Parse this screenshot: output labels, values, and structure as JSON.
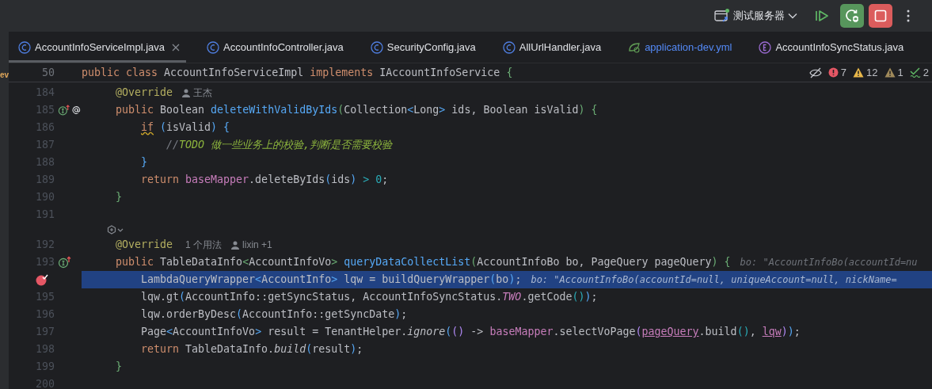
{
  "toolbar": {
    "run_config": "测试服务器"
  },
  "tabs": [
    {
      "label": "AccountInfoServiceImpl.java",
      "kind": "class",
      "selected": true,
      "modified": false
    },
    {
      "label": "AccountInfoController.java",
      "kind": "class",
      "selected": false,
      "modified": false
    },
    {
      "label": "SecurityConfig.java",
      "kind": "class",
      "selected": false,
      "modified": false
    },
    {
      "label": "AllUrlHandler.java",
      "kind": "class",
      "selected": false,
      "modified": false
    },
    {
      "label": "application-dev.yml",
      "kind": "spring",
      "selected": false,
      "modified": true
    },
    {
      "label": "AccountInfoSyncStatus.java",
      "kind": "enum",
      "selected": false,
      "modified": false
    }
  ],
  "side_fragment": "ev",
  "sticky_line": {
    "number": "50",
    "tokens": [
      {
        "t": "public class ",
        "kind": "keyword"
      },
      {
        "t": "AccountInfoServiceImpl ",
        "kind": "plain"
      },
      {
        "t": "implements ",
        "kind": "keyword"
      },
      {
        "t": "IAccountInfoService ",
        "kind": "plain"
      },
      {
        "t": "{",
        "kind": "brace1"
      }
    ]
  },
  "inspections": [
    {
      "kind": "error",
      "count": "7"
    },
    {
      "kind": "warning",
      "count": "12"
    },
    {
      "kind": "weak",
      "count": "1"
    },
    {
      "kind": "typo",
      "count": "2"
    }
  ],
  "lines": [
    {
      "number": "184",
      "implements": false,
      "mention": false,
      "breakpoint": false,
      "current": false,
      "tokens": [
        {
          "t": "@Override",
          "kind": "annotation"
        }
      ],
      "hints": [
        {
          "kind": "author",
          "t": "王杰"
        }
      ]
    },
    {
      "number": "185",
      "implements": true,
      "mention": true,
      "breakpoint": false,
      "current": false,
      "tokens": [
        {
          "t": "public",
          "kind": "keyword"
        },
        {
          "t": " Boolean ",
          "kind": "plain"
        },
        {
          "t": "deleteWithValidByIds",
          "kind": "method"
        },
        {
          "t": "(",
          "kind": "brace1"
        },
        {
          "t": "Collection",
          "kind": "plain"
        },
        {
          "t": "<",
          "kind": "brace2"
        },
        {
          "t": "Long",
          "kind": "plain"
        },
        {
          "t": ">",
          "kind": "brace2"
        },
        {
          "t": " ids, Boolean isValid",
          "kind": "plain"
        },
        {
          "t": ")",
          "kind": "brace1"
        },
        {
          "t": " {",
          "kind": "brace1"
        }
      ],
      "children": [
        {
          "number": "186",
          "implements": false,
          "mention": false,
          "breakpoint": false,
          "current": false,
          "tokens": [
            {
              "t": "if",
              "kind": "squiggle"
            },
            {
              "t": " (",
              "kind": "brace2"
            },
            {
              "t": "isValid",
              "kind": "plain"
            },
            {
              "t": ")",
              "kind": "brace2"
            },
            {
              "t": " {",
              "kind": "brace2"
            }
          ],
          "children": [
            {
              "number": "187",
              "implements": false,
              "mention": false,
              "breakpoint": false,
              "current": false,
              "tokens": [
                {
                  "t": "//",
                  "kind": "comment"
                },
                {
                  "t": "TODO 做一些业务上的校验,判断是否需要校验",
                  "kind": "todo"
                }
              ]
            }
          ]
        },
        {
          "number": "188",
          "implements": false,
          "mention": false,
          "breakpoint": false,
          "current": false,
          "tokens": [
            {
              "t": "}",
              "kind": "brace2"
            }
          ]
        },
        {
          "number": "189",
          "implements": false,
          "mention": false,
          "breakpoint": false,
          "current": false,
          "tokens": [
            {
              "t": "return ",
              "kind": "keyword"
            },
            {
              "t": "baseMapper",
              "kind": "field"
            },
            {
              "t": ".deleteByIds",
              "kind": "plain"
            },
            {
              "t": "(",
              "kind": "brace2"
            },
            {
              "t": "ids",
              "kind": "plain"
            },
            {
              "t": ")",
              "kind": "brace2"
            },
            {
              "t": " > ",
              "kind": "brace3"
            },
            {
              "t": "0",
              "kind": "number"
            },
            {
              "t": ";",
              "kind": "plain"
            }
          ]
        }
      ]
    },
    {
      "number": "190",
      "implements": false,
      "mention": false,
      "breakpoint": false,
      "current": false,
      "tokens": [
        {
          "t": "}",
          "kind": "brace1"
        }
      ]
    },
    {
      "number": "191",
      "implements": false,
      "mention": false,
      "breakpoint": false,
      "current": false
    },
    {
      "number": "192",
      "implements": false,
      "mention": false,
      "breakpoint": false,
      "current": false,
      "inlay_above": true,
      "tokens": [
        {
          "t": "@Override",
          "kind": "annotation"
        }
      ],
      "hints": [
        {
          "kind": "usages",
          "t": "1 个用法"
        },
        {
          "kind": "author",
          "t": "lixin +1"
        }
      ]
    },
    {
      "number": "193",
      "implements": true,
      "mention": false,
      "breakpoint": false,
      "current": false,
      "tokens": [
        {
          "t": "public",
          "kind": "keyword"
        },
        {
          "t": " TableDataInfo",
          "kind": "plain"
        },
        {
          "t": "<",
          "kind": "brace1"
        },
        {
          "t": "AccountInfoVo",
          "kind": "plain"
        },
        {
          "t": "> ",
          "kind": "brace1"
        },
        {
          "t": "queryDataCollectList",
          "kind": "method"
        },
        {
          "t": "(",
          "kind": "brace1"
        },
        {
          "t": "AccountInfoBo bo, PageQuery pageQuery",
          "kind": "plain"
        },
        {
          "t": ")",
          "kind": "brace1"
        },
        {
          "t": " {",
          "kind": "brace1"
        }
      ],
      "debug": "bo: \"AccountInfoBo(accountId=nu",
      "children": [
        {
          "implements": false,
          "mention": false,
          "breakpoint": true,
          "current": true,
          "tokens": [
            {
              "t": "LambdaQueryWrapper",
              "kind": "plain"
            },
            {
              "t": "<",
              "kind": "brace2"
            },
            {
              "t": "AccountInfo",
              "kind": "plain"
            },
            {
              "t": ">",
              "kind": "brace2"
            },
            {
              "t": " lqw = buildQueryWrapper",
              "kind": "plain"
            },
            {
              "t": "(",
              "kind": "brace2"
            },
            {
              "t": "bo",
              "kind": "plain"
            },
            {
              "t": ")",
              "kind": "brace2"
            },
            {
              "t": ";",
              "kind": "plain"
            }
          ],
          "debug": "bo: \"AccountInfoBo(accountId=null, uniqueAccount=null, nickName="
        },
        {
          "number": "195",
          "implements": false,
          "mention": false,
          "breakpoint": false,
          "current": false,
          "tokens": [
            {
              "t": "lqw.gt",
              "kind": "plain"
            },
            {
              "t": "(",
              "kind": "brace2"
            },
            {
              "t": "AccountInfo::getSyncStatus, AccountInfoSyncStatus.",
              "kind": "plain"
            },
            {
              "t": "TWO",
              "kind": "constant"
            },
            {
              "t": ".getCode",
              "kind": "plain"
            },
            {
              "t": "()",
              "kind": "brace3"
            },
            {
              "t": ")",
              "kind": "brace2"
            },
            {
              "t": ";",
              "kind": "plain"
            }
          ]
        },
        {
          "number": "196",
          "implements": false,
          "mention": false,
          "breakpoint": false,
          "current": false,
          "tokens": [
            {
              "t": "lqw.orderByDesc",
              "kind": "plain"
            },
            {
              "t": "(",
              "kind": "brace2"
            },
            {
              "t": "AccountInfo::getSyncDate",
              "kind": "plain"
            },
            {
              "t": ")",
              "kind": "brace2"
            },
            {
              "t": ";",
              "kind": "plain"
            }
          ]
        },
        {
          "number": "197",
          "implements": false,
          "mention": false,
          "breakpoint": false,
          "current": false,
          "tokens": [
            {
              "t": "Page",
              "kind": "plain"
            },
            {
              "t": "<",
              "kind": "brace2"
            },
            {
              "t": "AccountInfoVo",
              "kind": "plain"
            },
            {
              "t": ">",
              "kind": "brace2"
            },
            {
              "t": " result = TenantHelper.",
              "kind": "plain"
            },
            {
              "t": "ignore",
              "kind": "italic"
            },
            {
              "t": "(",
              "kind": "brace2"
            },
            {
              "t": "()",
              "kind": "brace4"
            },
            {
              "t": " -> ",
              "kind": "plain"
            },
            {
              "t": "baseMapper",
              "kind": "field"
            },
            {
              "t": ".selectVoPage",
              "kind": "plain"
            },
            {
              "t": "(",
              "kind": "brace4"
            },
            {
              "t": "pageQuery",
              "kind": "underline"
            },
            {
              "t": ".build",
              "kind": "plain"
            },
            {
              "t": "()",
              "kind": "brace3"
            },
            {
              "t": ", ",
              "kind": "plain"
            },
            {
              "t": "lqw",
              "kind": "underline"
            },
            {
              "t": ")",
              "kind": "brace4"
            },
            {
              "t": ")",
              "kind": "brace2"
            },
            {
              "t": ";",
              "kind": "plain"
            }
          ]
        },
        {
          "number": "198",
          "implements": false,
          "mention": false,
          "breakpoint": false,
          "current": false,
          "tokens": [
            {
              "t": "return",
              "kind": "keyword"
            },
            {
              "t": " TableDataInfo.",
              "kind": "plain"
            },
            {
              "t": "build",
              "kind": "italic"
            },
            {
              "t": "(",
              "kind": "brace2"
            },
            {
              "t": "result",
              "kind": "plain"
            },
            {
              "t": ")",
              "kind": "brace2"
            },
            {
              "t": ";",
              "kind": "plain"
            }
          ]
        }
      ]
    },
    {
      "number": "199",
      "implements": false,
      "mention": false,
      "breakpoint": false,
      "current": false,
      "tokens": [
        {
          "t": "}",
          "kind": "brace1"
        }
      ]
    },
    {
      "number": "200",
      "implements": false,
      "mention": false,
      "breakpoint": false,
      "current": false
    }
  ]
}
